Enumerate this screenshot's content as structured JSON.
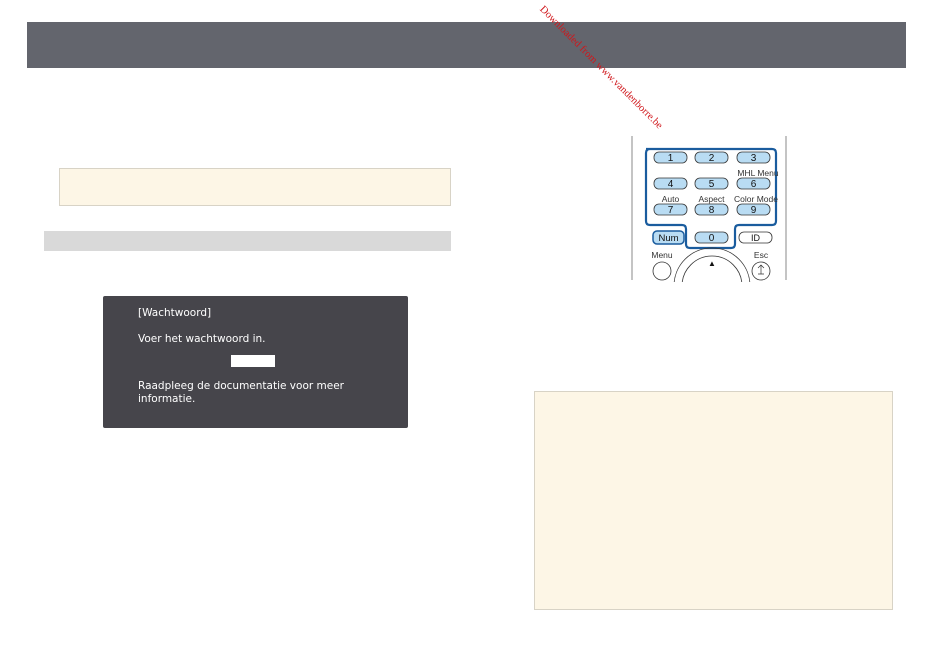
{
  "dialog": {
    "title": "[Wachtwoord]",
    "prompt": "Voer het wachtwoord in.",
    "info_line1": "Raadpleeg de documentatie voor meer",
    "info_line2": "informatie."
  },
  "remote": {
    "keys": {
      "k1": "1",
      "k2": "2",
      "k3": "3",
      "k4": "4",
      "k5": "5",
      "k6": "6",
      "k7": "7",
      "k8": "8",
      "k9": "9",
      "k0": "0",
      "num": "Num",
      "id": "ID"
    },
    "labels": {
      "mhl_menu": "MHL Menu",
      "auto": "Auto",
      "aspect": "Aspect",
      "color_mode": "Color Mode",
      "menu": "Menu",
      "esc": "Esc",
      "up_arrow": "▲"
    }
  },
  "watermark": "Downloaded from www.vandenborre.be",
  "colors": {
    "header": "#63656d",
    "note_background": "#fdf6e6",
    "section_bar": "#d9d9d9",
    "dialog_background": "#46454b",
    "key_fill": "#b9dcf3",
    "highlight_outline": "#1a5c9e",
    "watermark": "#d0161b"
  }
}
